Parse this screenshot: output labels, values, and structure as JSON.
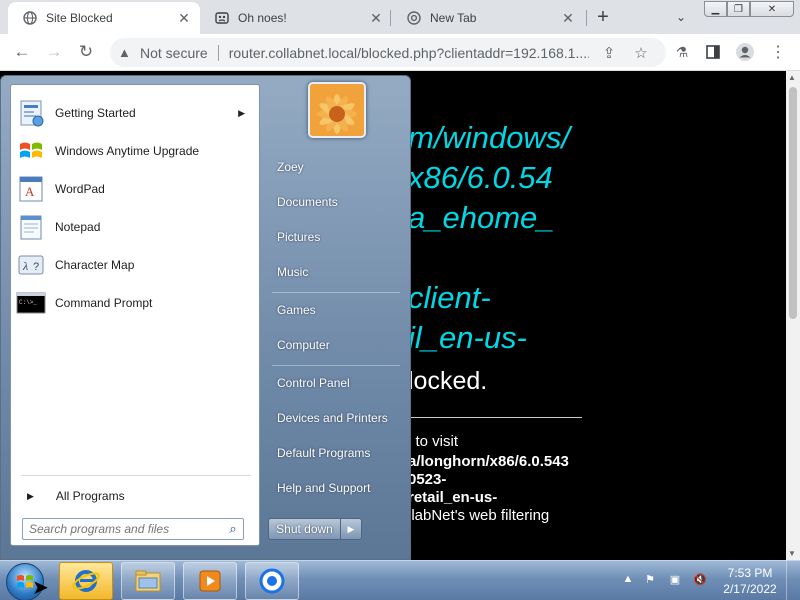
{
  "browser": {
    "tabs": [
      {
        "title": "Site Blocked",
        "active": true
      },
      {
        "title": "Oh noes!",
        "active": false
      },
      {
        "title": "New Tab",
        "active": false
      }
    ],
    "security_label": "Not secure",
    "url": "router.collabnet.local/blocked.php?clientaddr=192.168.1...."
  },
  "page": {
    "lines_cyan": [
      "m/windows/",
      "x86/6.0.54",
      "a_ehome_",
      "client-",
      "il_en-us-"
    ],
    "line_blocked": "locked.",
    "small_lines": [
      {
        "text": "l to visit",
        "bold": false
      },
      {
        "text": "a/longhorn/x86/6.0.543",
        "bold": true
      },
      {
        "text": "0523-",
        "bold": true
      },
      {
        "text": "retail_en-us-",
        "bold": true
      },
      {
        "text": "llabNet's web filtering",
        "bold": false
      }
    ]
  },
  "start_menu": {
    "programs": [
      {
        "label": "Getting Started",
        "icon": "getting-started-icon",
        "submenu": true
      },
      {
        "label": "Windows Anytime Upgrade",
        "icon": "windows-flag-icon",
        "submenu": false
      },
      {
        "label": "WordPad",
        "icon": "wordpad-icon",
        "submenu": false
      },
      {
        "label": "Notepad",
        "icon": "notepad-icon",
        "submenu": false
      },
      {
        "label": "Character Map",
        "icon": "character-map-icon",
        "submenu": false
      },
      {
        "label": "Command Prompt",
        "icon": "command-prompt-icon",
        "submenu": false
      }
    ],
    "all_programs": "All Programs",
    "search_placeholder": "Search programs and files",
    "right_items": [
      "Zoey",
      "Documents",
      "Pictures",
      "Music",
      "Games",
      "Computer",
      "Control Panel",
      "Devices and Printers",
      "Default Programs",
      "Help and Support"
    ],
    "shutdown_label": "Shut down"
  },
  "taskbar": {
    "pinned": [
      "internet-explorer-icon",
      "windows-explorer-icon",
      "media-player-icon",
      "chrome-icon"
    ],
    "time": "7:53 PM",
    "date": "2/17/2022"
  },
  "colors": {
    "page_bg": "#000000",
    "page_text_cyan": "#00d8e6",
    "taskbar": "#6f8fb7"
  }
}
